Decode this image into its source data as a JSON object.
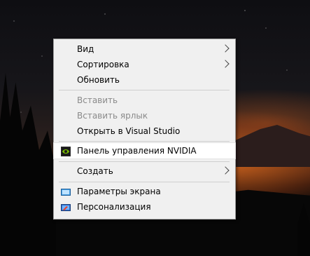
{
  "menu": {
    "items": [
      {
        "label": "Вид",
        "submenu": true
      },
      {
        "label": "Сортировка",
        "submenu": true
      },
      {
        "label": "Обновить"
      },
      {
        "label": "Вставить",
        "disabled": true
      },
      {
        "label": "Вставить ярлык",
        "disabled": true
      },
      {
        "label": "Открыть в Visual Studio"
      },
      {
        "label": "Панель управления NVIDIA",
        "icon": "nvidia-icon"
      },
      {
        "label": "Создать",
        "submenu": true
      },
      {
        "label": "Параметры экрана",
        "icon": "display-settings-icon"
      },
      {
        "label": "Персонализация",
        "icon": "personalization-icon"
      }
    ]
  },
  "colors": {
    "menu_bg": "#f0f0f0",
    "disabled_text": "#8a8a8a",
    "nvidia_green": "#76b900"
  }
}
